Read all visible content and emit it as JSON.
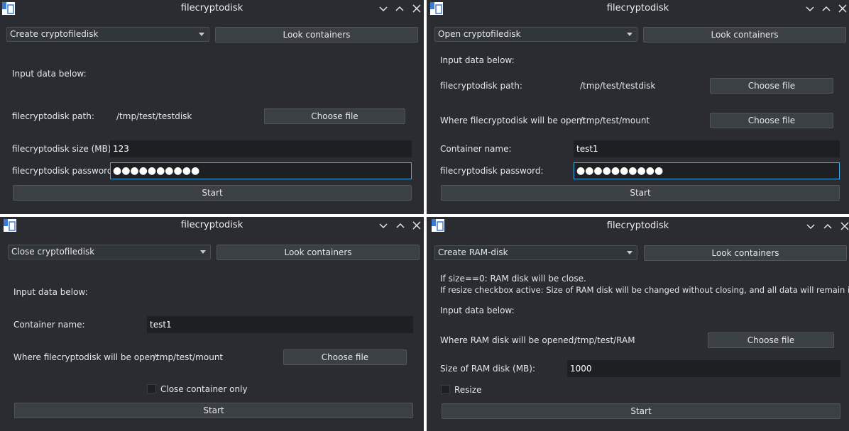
{
  "window_title": "filecryptodisk",
  "look_containers_label": "Look containers",
  "choose_file_label": "Choose file",
  "start_label": "Start",
  "create_panel": {
    "mode": "Create cryptofiledisk",
    "input_heading": "Input data below:",
    "path_label": "filecryptodisk path:",
    "path_value": "/tmp/test/testdisk",
    "size_label": "filecryptodisk size (MB):",
    "size_value": "123",
    "password_label": "filecryptodisk password:",
    "password_value": "●●●●●●●●●●"
  },
  "open_panel": {
    "mode": "Open cryptofiledisk",
    "input_heading": "Input data below:",
    "path_label": "filecryptodisk path:",
    "path_value": "/tmp/test/testdisk",
    "mount_label": "Where filecryptodisk will be open:",
    "mount_value": "/tmp/test/mount",
    "container_label": "Container name:",
    "container_value": "test1",
    "password_label": "filecryptodisk password:",
    "password_value": "●●●●●●●●●●"
  },
  "close_panel": {
    "mode": "Close cryptofiledisk",
    "input_heading": "Input data below:",
    "container_label": "Container name:",
    "container_value": "test1",
    "mount_label": "Where filecryptodisk will be open:",
    "mount_value": "/tmp/test/mount",
    "close_only_label": "Close container only",
    "close_only_checked": false
  },
  "ram_panel": {
    "mode": "Create RAM-disk",
    "info_line1": "If size==0: RAM disk will be close.",
    "info_line2": "If resize checkbox active: Size of RAM disk will be changed without closing, and all data will remain in place",
    "input_heading": "Input data below:",
    "ram_path_label": "Where RAM disk will be opened:",
    "ram_path_value": "/tmp/test/RAM",
    "size_label": "Size of RAM disk (MB):",
    "size_value": "1000",
    "resize_label": "Resize",
    "resize_checked": false
  },
  "colors": {
    "window_bg": "#2a2c31",
    "field_bg": "#1d1f22",
    "focus_border": "#3daee9",
    "separator": "#ffffff"
  },
  "icons": [
    "app-icon",
    "minimize-icon",
    "maximize-icon",
    "close-icon"
  ]
}
